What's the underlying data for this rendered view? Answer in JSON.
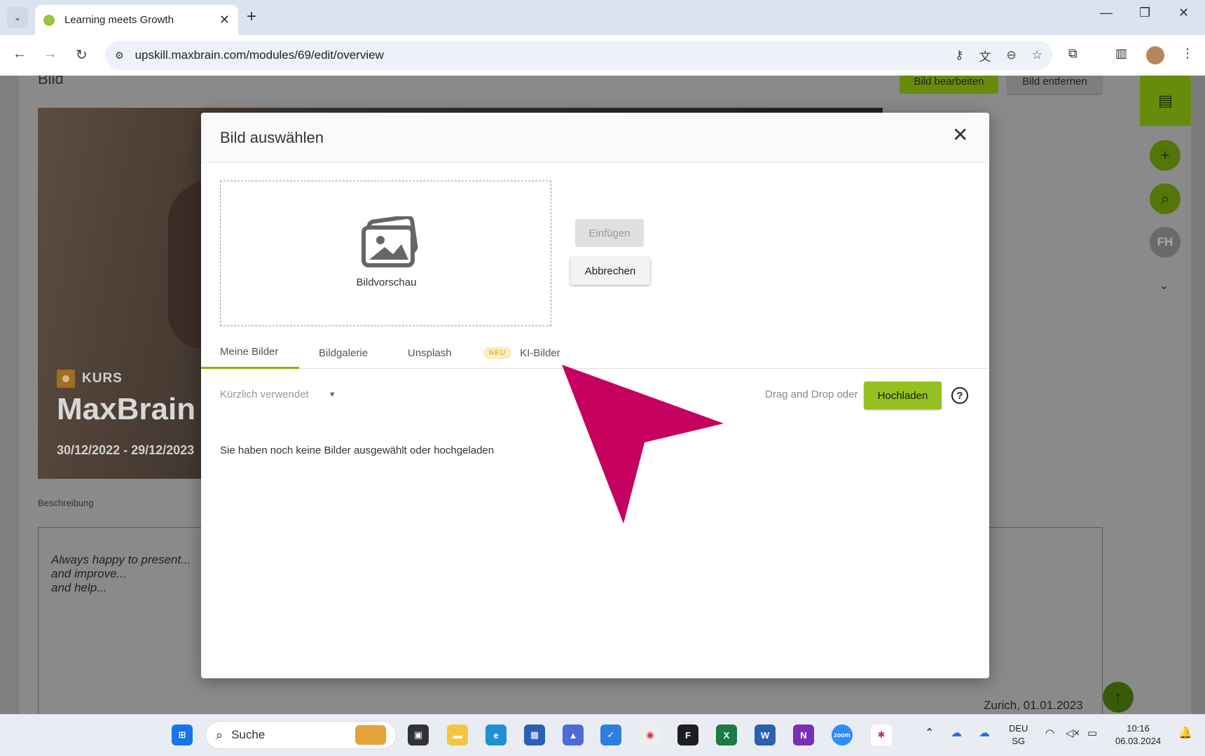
{
  "browser": {
    "tab_title": "Learning meets Growth",
    "url": "upskill.maxbrain.com/modules/69/edit/overview",
    "icons": [
      "chevron-down-icon",
      "close-icon",
      "plus-icon",
      "back-icon",
      "forward-icon",
      "reload-icon",
      "site-settings-icon",
      "key-icon",
      "translate-icon",
      "zoom-icon",
      "star-icon",
      "extensions-icon",
      "sidepanel-icon",
      "profile-avatar",
      "more-icon",
      "minimize-icon",
      "restore-icon",
      "close-window-icon"
    ]
  },
  "page": {
    "section_label": "Bild",
    "edit_image_button": "Bild bearbeiten",
    "remove_image_button": "Bild entfernen",
    "course_badge": "KURS",
    "course_title": "MaxBrain D",
    "course_dates": "30/12/2022 - 29/12/2023",
    "description_label": "Beschreibung",
    "description_lines": [
      "Always happy to present...",
      "and improve...",
      "and help..."
    ],
    "location_date": "Zurich, 01.01.2023",
    "rail_initials": "FH"
  },
  "modal": {
    "title": "Bild auswählen",
    "preview_label": "Bildvorschau",
    "insert_button": "Einfügen",
    "cancel_button": "Abbrechen",
    "tabs": [
      {
        "label": "Meine Bilder",
        "active": true
      },
      {
        "label": "Bildgalerie",
        "active": false
      },
      {
        "label": "Unsplash",
        "active": false
      },
      {
        "label": "KI-Bilder",
        "active": false,
        "badge": "NEU"
      }
    ],
    "filter_value": "Kürzlich verwendet",
    "drag_text": "Drag and Drop oder",
    "upload_button": "Hochladen",
    "empty_message": "Sie haben noch keine Bilder ausgewählt oder hochgeladen"
  },
  "taskbar": {
    "search_label": "Suche",
    "lang_line1": "DEU",
    "lang_line2": "SG",
    "time": "10:16",
    "date": "06.03.2024"
  },
  "colors": {
    "accent_green": "#94c11f",
    "dark_green": "#678c0b",
    "pointer_magenta": "#c5005f"
  }
}
